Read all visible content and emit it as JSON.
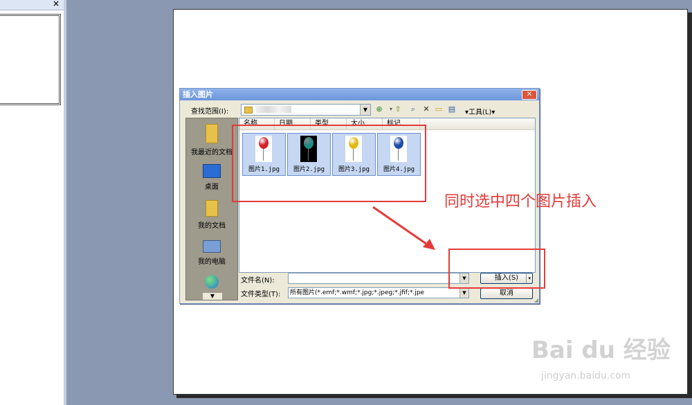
{
  "pane": {
    "close_glyph": "×"
  },
  "dialog": {
    "title": "插入图片",
    "close_glyph": "✕",
    "lookin_label": "查找范围(I):",
    "tools_label": "▾工具(L)▾",
    "places": [
      {
        "label": "我最近的文档",
        "icon": "recent-documents-icon"
      },
      {
        "label": "桌面",
        "icon": "desktop-icon"
      },
      {
        "label": "我的文档",
        "icon": "my-documents-icon"
      },
      {
        "label": "我的电脑",
        "icon": "my-computer-icon"
      },
      {
        "label": "",
        "icon": "network-places-icon"
      }
    ],
    "columns": [
      "名称",
      "日期",
      "类型",
      "大小",
      "标记"
    ],
    "files": [
      {
        "name": "图片1.jpg",
        "balloon_color": "#d61f2b",
        "bg": "#ffffff"
      },
      {
        "name": "图片2.jpg",
        "balloon_color": "#1f8c86",
        "bg": "#000000"
      },
      {
        "name": "图片3.jpg",
        "balloon_color": "#e2b813",
        "bg": "#ffffff"
      },
      {
        "name": "图片4.jpg",
        "balloon_color": "#1e4aa8",
        "bg": "#ffffff"
      }
    ],
    "filename_label": "文件名(N):",
    "filename_value": "",
    "filetype_label": "文件类型(T):",
    "filetype_value": "所有图片(*.emf;*.wmf;*.jpg;*.jpeg;*.jfif;*.jpe",
    "insert_button": "插入(S)",
    "cancel_button": "取消"
  },
  "annotation": {
    "text": "同时选中四个图片插入",
    "color": "#e53a3a"
  },
  "watermark": {
    "text": "Bai du 经验",
    "sub": "jingyan.baidu.com"
  }
}
